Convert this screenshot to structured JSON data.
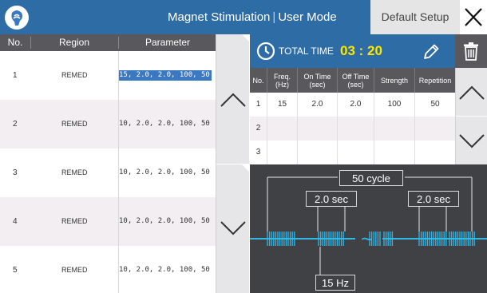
{
  "header": {
    "title": "Magnet Stimulation",
    "mode": "User Mode",
    "default_setup_label": "Default Setup"
  },
  "left_table": {
    "columns": [
      "No.",
      "Region",
      "Parameter"
    ],
    "rows": [
      {
        "no": "1",
        "region": "REMED",
        "parameter": "15, 2.0, 2.0, 100, 50",
        "selected": true
      },
      {
        "no": "2",
        "region": "REMED",
        "parameter": "10, 2.0, 2.0, 100, 50"
      },
      {
        "no": "3",
        "region": "REMED",
        "parameter": "10, 2.0, 2.0, 100, 50"
      },
      {
        "no": "4",
        "region": "REMED",
        "parameter": "10, 2.0, 2.0, 100, 50"
      },
      {
        "no": "5",
        "region": "REMED",
        "parameter": "10, 2.0, 2.0, 100, 50"
      }
    ]
  },
  "total": {
    "label": "TOTAL TIME",
    "time": "03 : 20"
  },
  "param_table": {
    "columns": [
      "No.",
      "Freq. (Hz)",
      "On Time (sec)",
      "Off Time (sec)",
      "Strength",
      "Repetition"
    ],
    "rows": [
      {
        "no": "1",
        "freq": "15",
        "on": "2.0",
        "off": "2.0",
        "strength": "100",
        "repetition": "50"
      },
      {
        "no": "2",
        "freq": "",
        "on": "",
        "off": "",
        "strength": "",
        "repetition": ""
      },
      {
        "no": "3",
        "freq": "",
        "on": "",
        "off": "",
        "strength": "",
        "repetition": ""
      }
    ]
  },
  "waveform": {
    "cycle_label": "50 cycle",
    "on_label": "2.0 sec",
    "off_label": "2.0 sec",
    "freq_label": "15 Hz",
    "gap_symbol": "~"
  },
  "icons": {
    "logo": "brand-logo-icon",
    "close": "close-icon",
    "clock": "clock-icon",
    "edit": "pencil-icon",
    "delete": "trash-icon",
    "scroll_up": "chevron-up-icon",
    "scroll_down": "chevron-down-icon"
  },
  "colors": {
    "header_blue": "#2e6ca6",
    "dark_gray": "#58585d",
    "time_yellow": "#ffe600",
    "wave_cyan": "#2fb9e6",
    "selection_blue": "#3a78c2",
    "wave_background": "#404145"
  }
}
